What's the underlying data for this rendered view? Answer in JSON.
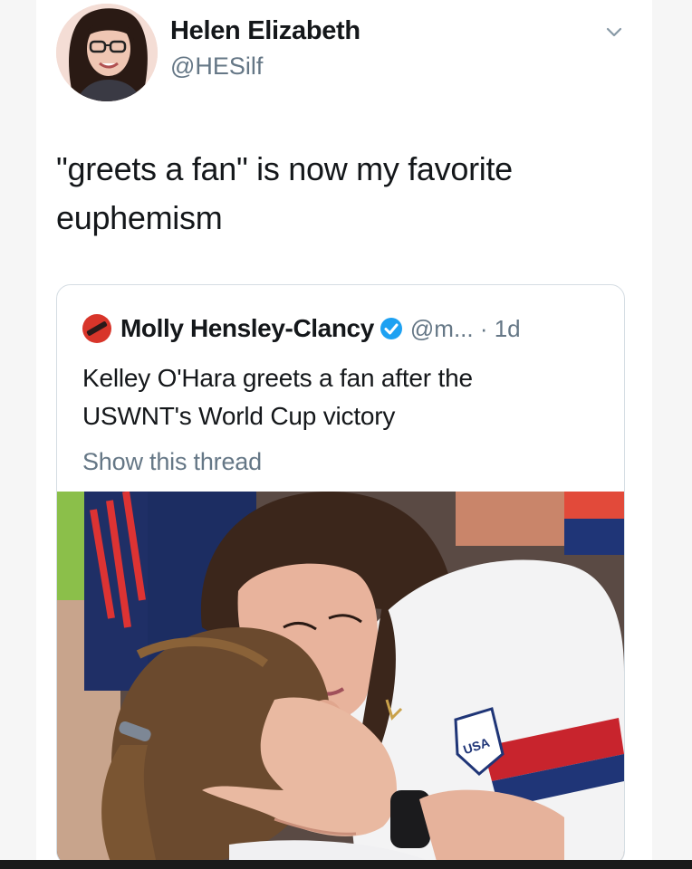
{
  "tweet": {
    "author_name": "Helen Elizabeth",
    "author_handle": "@HESilf",
    "text_line1": "\"greets a fan\" is now my favorite",
    "text_line2": "euphemism"
  },
  "quoted_tweet": {
    "author_name": "Molly Hensley-Clancy",
    "meta": "@m... · 1d",
    "text_line1": "Kelley O'Hara greets a fan after the",
    "text_line2": "USWNT's World Cup victory",
    "show_thread_label": "Show this thread",
    "photo_badge_text": "USA"
  },
  "icons": {
    "caret": "chevron-down-icon",
    "verified": "verified-badge-icon",
    "source_logo": "news-logo-icon"
  },
  "colors": {
    "verified_blue": "#1da1f2",
    "secondary_text": "#657786",
    "logo_red": "#d8352a"
  }
}
